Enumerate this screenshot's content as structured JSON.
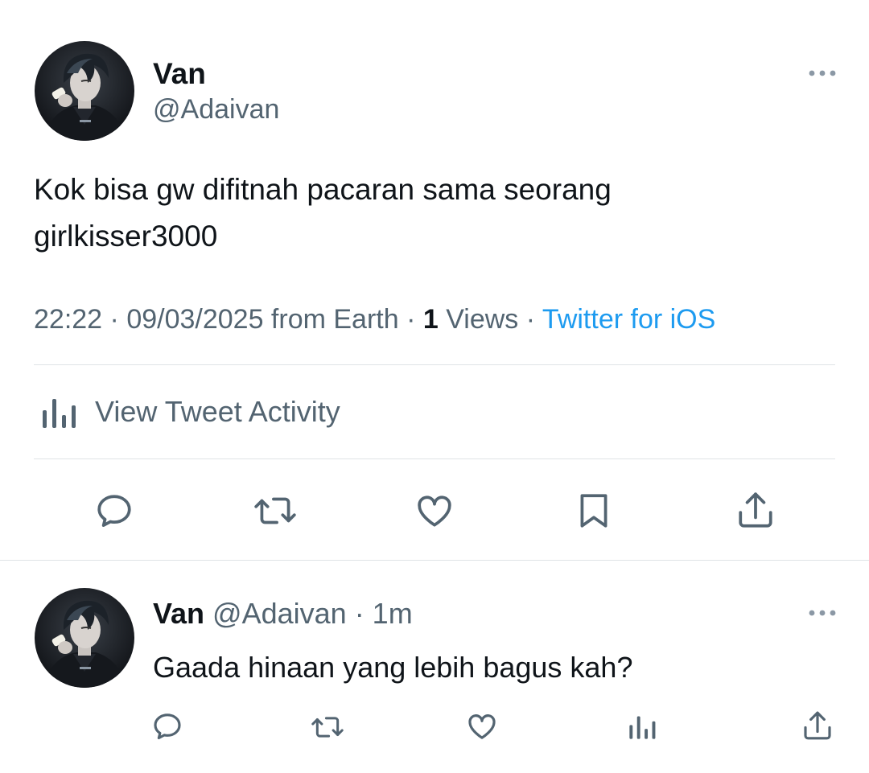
{
  "tweet": {
    "author": {
      "name": "Van",
      "handle": "@Adaivan"
    },
    "text": "Kok bisa gw difitnah pacaran sama seorang\ngirlkisser3000",
    "meta": {
      "time": "22:22",
      "sep1": " · ",
      "date_location": "09/03/2025 from Earth",
      "sep2": " · ",
      "views_count": "1",
      "views_label": " Views",
      "sep3": " · ",
      "source": "Twitter for iOS"
    },
    "activity_label": "View Tweet Activity"
  },
  "reply": {
    "name": "Van",
    "handle_time": " @Adaivan · 1m",
    "text": "Gaada hinaan yang lebih bagus kah?"
  },
  "icons": {
    "more": "more-horizontal-icon",
    "reply": "comment-bubble-icon",
    "retweet": "retweet-icon",
    "like": "heart-icon",
    "bookmark": "bookmark-icon",
    "share": "share-upload-icon",
    "analytics": "bar-chart-icon"
  },
  "colors": {
    "link": "#1d9bf0",
    "secondary_text": "#536471",
    "primary_text": "#0f1419",
    "divider": "#dfe3e6"
  }
}
